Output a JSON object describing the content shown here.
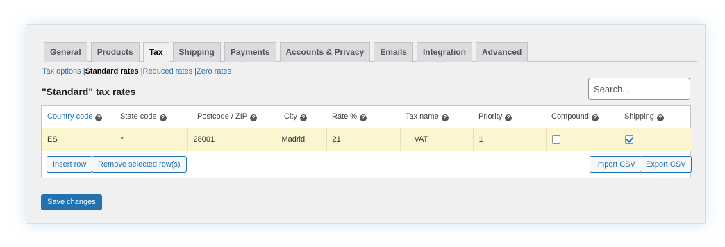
{
  "tabs": [
    "General",
    "Products",
    "Tax",
    "Shipping",
    "Payments",
    "Accounts & Privacy",
    "Emails",
    "Integration",
    "Advanced"
  ],
  "active_tab": "Tax",
  "subnav": {
    "items": [
      {
        "label": "Tax options",
        "current": false
      },
      {
        "label": "Standard rates",
        "current": true
      },
      {
        "label": "Reduced rates",
        "current": false
      },
      {
        "label": "Zero rates",
        "current": false
      }
    ],
    "separator": "|"
  },
  "section_title": "\"Standard\" tax rates",
  "search": {
    "placeholder": "Search...",
    "value": ""
  },
  "table": {
    "columns": [
      "Country code",
      "State code",
      "Postcode / ZIP",
      "City",
      "Rate %",
      "Tax name",
      "Priority",
      "Compound",
      "Shipping"
    ],
    "help_icon": "question-mark-icon",
    "rows": [
      {
        "country": "ES",
        "state": "*",
        "postcode": "28001",
        "city": "Madrid",
        "rate": "21",
        "tax_name": "VAT",
        "priority": "1",
        "compound": false,
        "shipping": true
      }
    ]
  },
  "buttons": {
    "insert_row": "Insert row",
    "remove_selected": "Remove selected row(s)",
    "import_csv": "Import CSV",
    "export_csv": "Export CSV",
    "save": "Save changes"
  },
  "colors": {
    "accent": "#2271b1",
    "row_highlight": "#fbf6d0",
    "panel_bg": "#f0f0f1"
  }
}
